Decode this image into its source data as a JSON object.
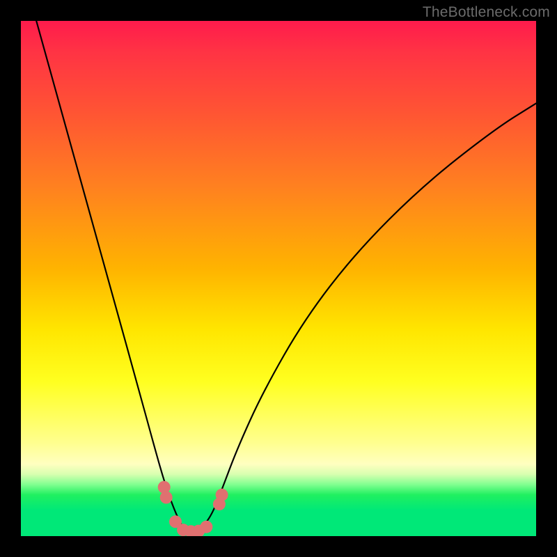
{
  "watermark": "TheBottleneck.com",
  "chart_data": {
    "type": "line",
    "title": "",
    "xlabel": "",
    "ylabel": "",
    "xlim": [
      0,
      100
    ],
    "ylim": [
      0,
      100
    ],
    "series": [
      {
        "name": "bottleneck-curve",
        "x": [
          3,
          8,
          13,
          18,
          23,
          26,
          28,
          30,
          31.5,
          32.5,
          33.5,
          35,
          37,
          39,
          42,
          47,
          55,
          65,
          78,
          92,
          100
        ],
        "y": [
          100,
          82,
          64,
          46,
          28,
          17,
          10,
          4.5,
          1.5,
          0.8,
          0.8,
          1.5,
          4,
          9,
          17,
          28,
          42,
          55,
          68,
          79,
          84
        ]
      }
    ],
    "markers": {
      "name": "highlight-points",
      "color": "#e07070",
      "points": [
        {
          "x": 27.8,
          "y": 9.5
        },
        {
          "x": 28.2,
          "y": 7.5
        },
        {
          "x": 30.0,
          "y": 2.8
        },
        {
          "x": 31.5,
          "y": 1.2
        },
        {
          "x": 33.0,
          "y": 0.9
        },
        {
          "x": 34.5,
          "y": 1.0
        },
        {
          "x": 36.0,
          "y": 1.8
        },
        {
          "x": 38.5,
          "y": 6.2
        },
        {
          "x": 39.0,
          "y": 8.0
        }
      ]
    },
    "background_gradient": {
      "top": "#ff1b4c",
      "mid_upper": "#ffb300",
      "mid": "#ffff20",
      "mid_lower": "#ffffc0",
      "bottom": "#00e878"
    }
  }
}
